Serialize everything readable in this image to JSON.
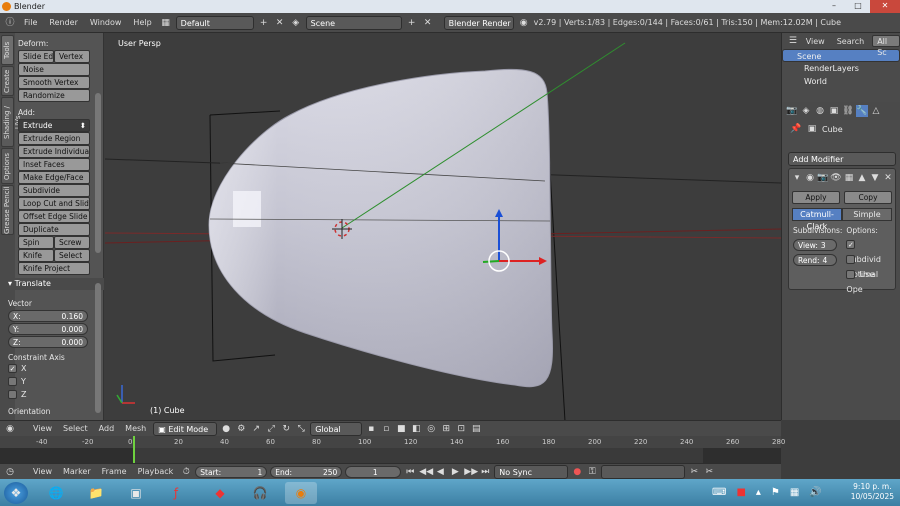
{
  "window": {
    "title": "Blender",
    "controls": [
      "–",
      "□",
      "✕"
    ]
  },
  "info_bar": {
    "menus": [
      "File",
      "Render",
      "Window",
      "Help"
    ],
    "layout": "Default",
    "scene": "Scene",
    "engine": "Blender Render",
    "stats": "v2.79 | Verts:1/83 | Edges:0/144 | Faces:0/61 | Tris:150 | Mem:12.02M | Cube"
  },
  "tool_shelf": {
    "tabs": [
      "Tools",
      "Create",
      "Shading / UVs",
      "Options",
      "Grease Pencil"
    ],
    "deform_label": "Deform:",
    "deform_buttons": [
      [
        "Slide Ed",
        "Vertex"
      ],
      [
        "Noise"
      ],
      [
        "Smooth Vertex"
      ],
      [
        "Randomize"
      ]
    ],
    "add_label": "Add:",
    "extrude": "Extrude",
    "add_buttons": [
      [
        "Extrude Region"
      ],
      [
        "Extrude Individual"
      ],
      [
        "Inset Faces"
      ],
      [
        "Make Edge/Face"
      ],
      [
        "Subdivide"
      ],
      [
        "Loop Cut and Slide"
      ],
      [
        "Offset Edge Slide"
      ],
      [
        "Duplicate"
      ],
      [
        "Spin",
        "Screw"
      ],
      [
        "Knife",
        "Select"
      ],
      [
        "Knife Project"
      ]
    ],
    "operator_title": "Translate",
    "vector_label": "Vector",
    "vector": [
      {
        "axis": "X:",
        "value": "0.160"
      },
      {
        "axis": "Y:",
        "value": "0.000"
      },
      {
        "axis": "Z:",
        "value": "0.000"
      }
    ],
    "constraint_label": "Constraint Axis",
    "constraints": [
      {
        "label": "X",
        "checked": true
      },
      {
        "label": "Y",
        "checked": false
      },
      {
        "label": "Z",
        "checked": false
      }
    ],
    "orientation_label": "Orientation"
  },
  "viewport": {
    "view_label": "User Persp",
    "object_label": "(1) Cube"
  },
  "view3d_header": {
    "menus": [
      "View",
      "Select",
      "Add",
      "Mesh"
    ],
    "mode": "Edit Mode",
    "orientation": "Global"
  },
  "timeline": {
    "ticks": [
      "-40",
      "-20",
      "0",
      "20",
      "40",
      "60",
      "80",
      "100",
      "120",
      "140",
      "160",
      "180",
      "200",
      "220",
      "240",
      "260",
      "280"
    ],
    "menus": [
      "View",
      "Marker",
      "Frame",
      "Playback"
    ],
    "start_label": "Start:",
    "start": "1",
    "end_label": "End:",
    "end": "250",
    "current": "1",
    "sync": "No Sync"
  },
  "outliner": {
    "tabs": [
      "View",
      "Search",
      "All Sc"
    ],
    "items": [
      "Scene",
      "RenderLayers",
      "World"
    ]
  },
  "properties": {
    "object_name": "Cube",
    "add_modifier": "Add Modifier",
    "apply": "Apply",
    "copy": "Copy",
    "types": [
      "Catmull-Clark",
      "Simple"
    ],
    "subdivisions_label": "Subdivisions:",
    "options_label": "Options:",
    "view_label": "View:",
    "view_value": "3",
    "render_label": "Rend:",
    "render_value": "4",
    "options": [
      {
        "label": "Subdivid",
        "checked": true
      },
      {
        "label": "Optimal",
        "checked": false
      },
      {
        "label": "Use Ope",
        "checked": false
      }
    ]
  },
  "taskbar": {
    "time": "9:10 p. m.",
    "date": "10/05/2025"
  },
  "colors": {
    "accent": "#5680c2",
    "viewport_bg": "#3d3d3d",
    "mesh": "#c8c8d6",
    "title_bar": "#dfe6ee"
  }
}
